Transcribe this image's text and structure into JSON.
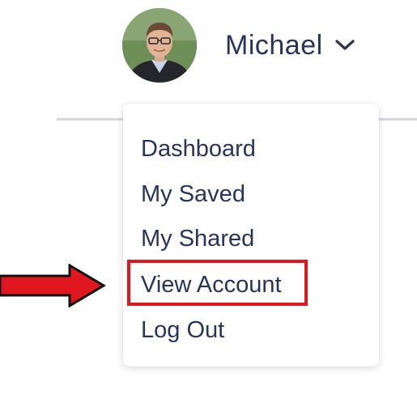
{
  "user": {
    "name": "Michael"
  },
  "menu": {
    "items": [
      {
        "label": "Dashboard"
      },
      {
        "label": "My Saved"
      },
      {
        "label": "My Shared"
      },
      {
        "label": "View Account"
      },
      {
        "label": "Log Out"
      }
    ],
    "highlighted_item": "View Account"
  },
  "annotations": {
    "arrow_color": "#e0171f",
    "highlight_color": "#e0171f"
  },
  "colors": {
    "text": "#2a3458",
    "divider": "#d5d7dc"
  },
  "icons": {
    "dropdown": "chevron-down-icon",
    "pointer": "red-arrow-icon"
  }
}
